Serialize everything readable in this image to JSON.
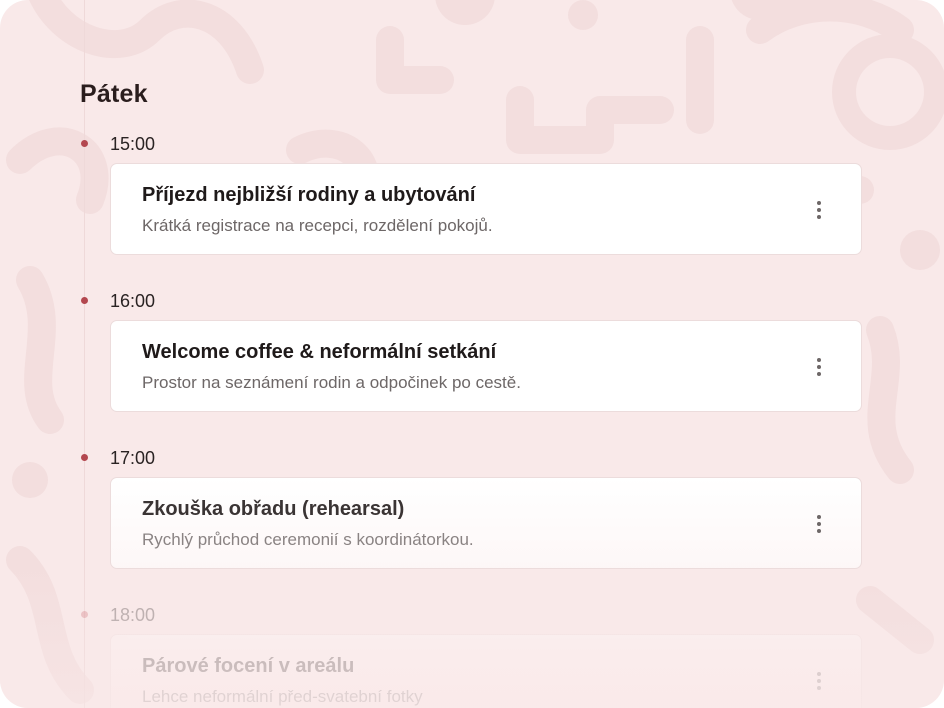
{
  "colors": {
    "background": "#f9e9e9",
    "accent_dot": "#b3474f",
    "card": "#ffffff"
  },
  "schedule": {
    "day_title": "Pátek",
    "events": [
      {
        "time": "15:00",
        "title": "Příjezd nejbližší rodiny a ubytování",
        "description": "Krátká registrace na recepci, rozdělení pokojů.",
        "menu_icon": "more-vertical-icon"
      },
      {
        "time": "16:00",
        "title": "Welcome coffee & neformální setkání",
        "description": "Prostor na seznámení rodin a odpočinek po cestě.",
        "menu_icon": "more-vertical-icon"
      },
      {
        "time": "17:00",
        "title": "Zkouška obřadu (rehearsal)",
        "description": "Rychlý průchod ceremonií s koordinátorkou.",
        "menu_icon": "more-vertical-icon"
      },
      {
        "time": "18:00",
        "title": "Párové focení v areálu",
        "description": "Lehce neformální před-svatební fotky",
        "menu_icon": "more-vertical-icon"
      }
    ]
  }
}
